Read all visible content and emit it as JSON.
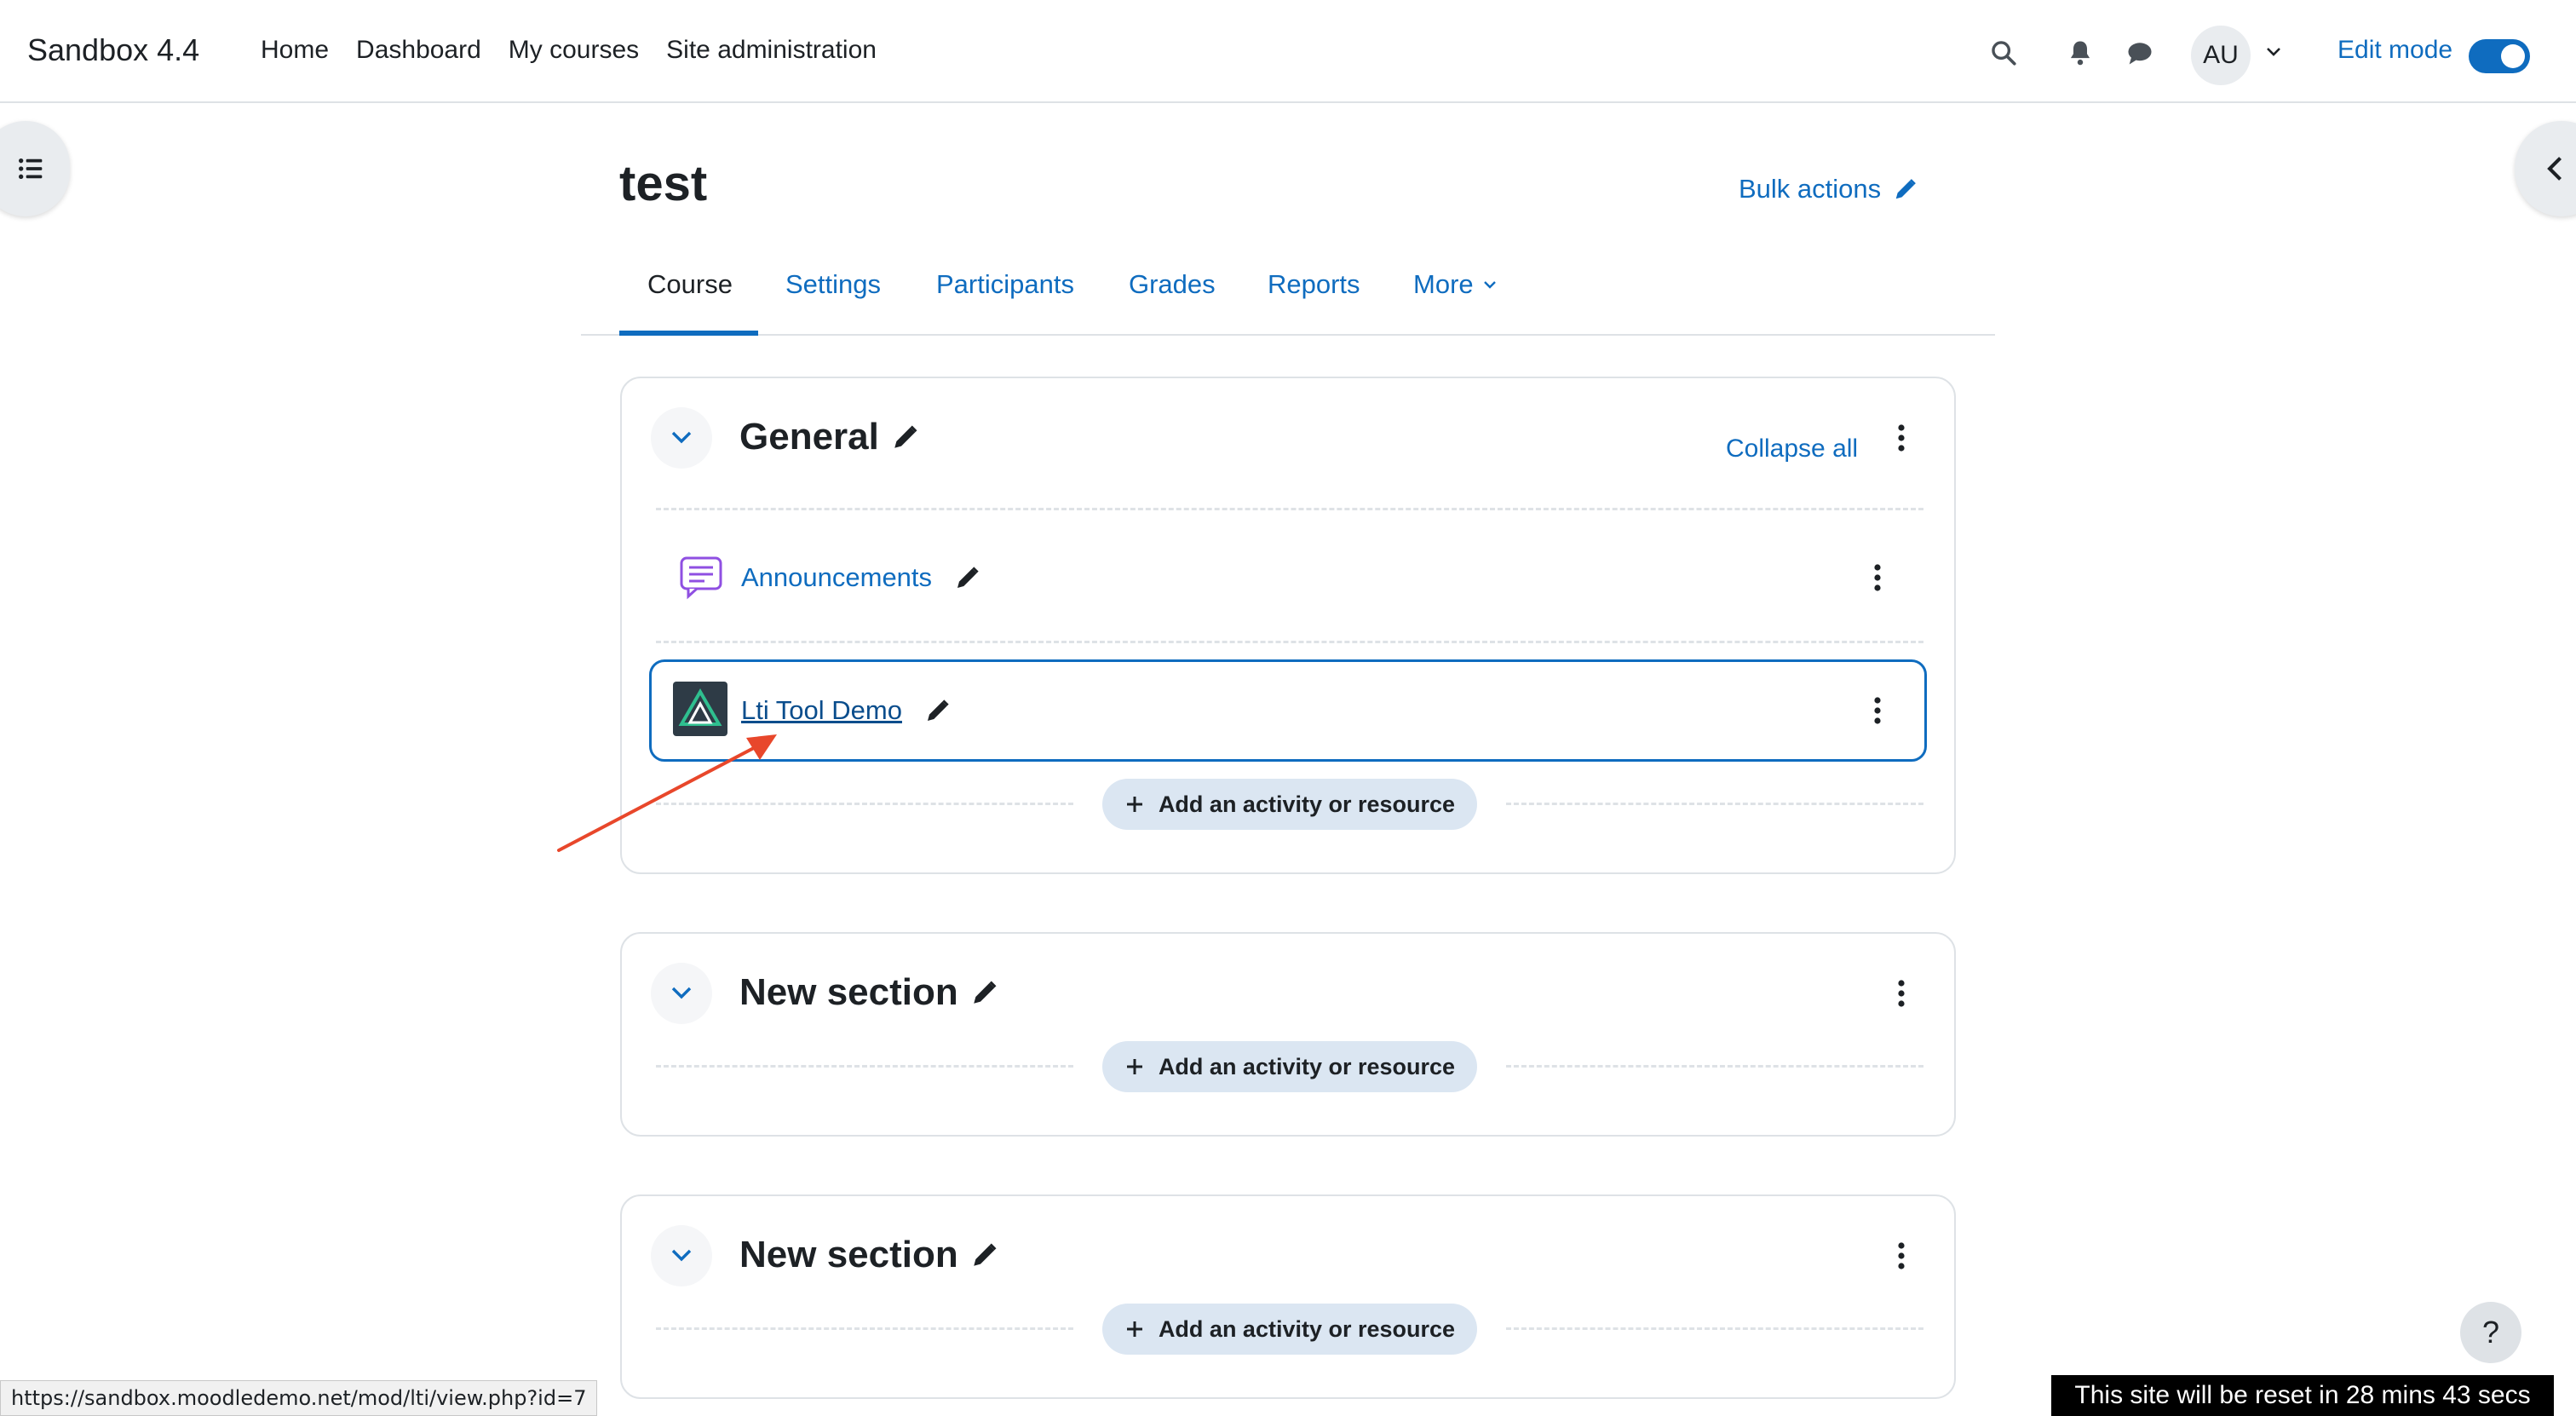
{
  "navbar": {
    "brand": "Sandbox 4.4",
    "links": [
      "Home",
      "Dashboard",
      "My courses",
      "Site administration"
    ],
    "avatar_initials": "AU",
    "edit_mode_label": "Edit mode",
    "edit_mode_on": true
  },
  "header": {
    "course_title": "test",
    "bulk_actions": "Bulk actions"
  },
  "tabs": [
    {
      "label": "Course",
      "active": true
    },
    {
      "label": "Settings",
      "active": false
    },
    {
      "label": "Participants",
      "active": false
    },
    {
      "label": "Grades",
      "active": false
    },
    {
      "label": "Reports",
      "active": false
    },
    {
      "label": "More",
      "active": false
    }
  ],
  "sections": [
    {
      "title": "General",
      "collapse_all": "Collapse all",
      "activities": [
        {
          "name": "Announcements",
          "icon": "forum-icon"
        },
        {
          "name": "Lti Tool Demo",
          "icon": "lti-tool-icon"
        }
      ],
      "add_label": "Add an activity or resource"
    },
    {
      "title": "New section",
      "add_label": "Add an activity or resource"
    },
    {
      "title": "New section",
      "add_label": "Add an activity or resource"
    }
  ],
  "status_url": "https://sandbox.moodledemo.net/mod/lti/view.php?id=7",
  "reset_banner": "This site will be reset in 28 mins 43 secs",
  "help_label": "?",
  "colors": {
    "link": "#0f6cbf",
    "annotation_arrow": "#e8472b"
  }
}
